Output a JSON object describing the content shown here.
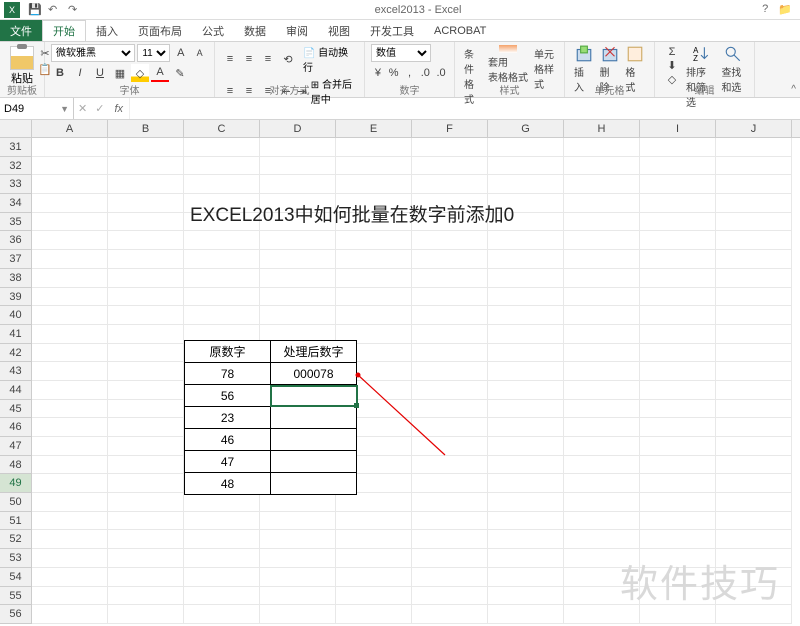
{
  "title": "excel2013 - Excel",
  "qat": {
    "save": "💾",
    "undo": "↶",
    "redo": "↷"
  },
  "tabs": [
    "文件",
    "开始",
    "插入",
    "页面布局",
    "公式",
    "数据",
    "审阅",
    "视图",
    "开发工具",
    "ACROBAT"
  ],
  "active_tab_index": 1,
  "ribbon": {
    "clipboard": {
      "paste": "粘贴",
      "label": "剪贴板"
    },
    "font": {
      "family": "微软雅黑",
      "size": "11",
      "bold": "B",
      "italic": "I",
      "underline": "U",
      "label": "字体"
    },
    "alignment": {
      "wrap": "自动换行",
      "merge": "合并后居中",
      "label": "对齐方式"
    },
    "number": {
      "format": "数值",
      "label": "数字"
    },
    "styles": {
      "cond": "条件格式",
      "table": "套用\n表格格式",
      "cell": "单元格样式",
      "label": "样式"
    },
    "cells": {
      "insert": "插入",
      "delete": "删除",
      "format": "格式",
      "label": "单元格"
    },
    "editing": {
      "sort": "排序和筛选",
      "find": "查找和选",
      "label": "编辑"
    }
  },
  "name_box": "D49",
  "formula": "",
  "columns": [
    "A",
    "B",
    "C",
    "D",
    "E",
    "F",
    "G",
    "H",
    "I",
    "J"
  ],
  "row_start": 31,
  "row_end": 56,
  "selected_row": 49,
  "big_title": "EXCEL2013中如何批量在数字前添加0",
  "table": {
    "headers": [
      "原数字",
      "处理后数字"
    ],
    "rows": [
      [
        "78",
        "000078"
      ],
      [
        "56",
        ""
      ],
      [
        "23",
        ""
      ],
      [
        "46",
        ""
      ],
      [
        "47",
        ""
      ],
      [
        "48",
        ""
      ]
    ]
  },
  "watermark": "软件技巧",
  "colors": {
    "accent": "#217346"
  }
}
